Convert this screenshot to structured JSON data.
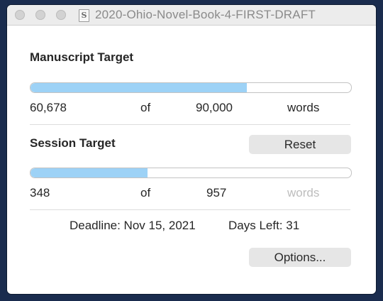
{
  "window": {
    "title": "2020-Ohio-Novel-Book-4-FIRST-DRAFT",
    "doc_icon_glyph": "S"
  },
  "manuscript": {
    "heading": "Manuscript Target",
    "current": "60,678",
    "of_label": "of",
    "target": "90,000",
    "unit": "words",
    "progress": 0.674
  },
  "session": {
    "heading": "Session Target",
    "reset_label": "Reset",
    "current": "348",
    "of_label": "of",
    "target": "957",
    "unit": "words",
    "progress": 0.364
  },
  "footer": {
    "deadline": "Deadline: Nov 15, 2021",
    "days_left": "Days Left: 31",
    "options_label": "Options..."
  },
  "colors": {
    "progress_fill": "#9dd2f6",
    "background": "#1a2c4e"
  }
}
